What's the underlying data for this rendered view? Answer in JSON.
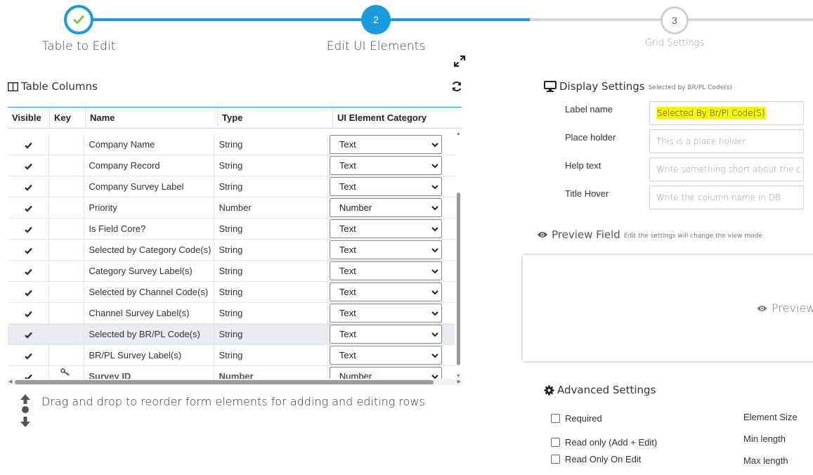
{
  "stepper": {
    "steps": [
      {
        "label": "Table to Edit",
        "number": "",
        "state": "done"
      },
      {
        "label": "Edit UI Elements",
        "number": "2",
        "state": "active"
      },
      {
        "label": "Grid Settings",
        "number": "3",
        "state": "pending"
      }
    ]
  },
  "table_panel": {
    "title": "Table Columns",
    "columns": [
      "Visible",
      "Key",
      "Name",
      "Type",
      "UI Element Category"
    ],
    "rows": [
      {
        "visible": true,
        "key": false,
        "name": "Company Name",
        "type": "String",
        "category": "Text"
      },
      {
        "visible": true,
        "key": false,
        "name": "Company Record",
        "type": "String",
        "category": "Text"
      },
      {
        "visible": true,
        "key": false,
        "name": "Company Survey Label",
        "type": "String",
        "category": "Text"
      },
      {
        "visible": true,
        "key": false,
        "name": "Priority",
        "type": "Number",
        "category": "Number"
      },
      {
        "visible": true,
        "key": false,
        "name": "Is Field Core?",
        "type": "String",
        "category": "Text"
      },
      {
        "visible": true,
        "key": false,
        "name": "Selected by Category Code(s)",
        "type": "String",
        "category": "Text"
      },
      {
        "visible": true,
        "key": false,
        "name": "Category Survey Label(s)",
        "type": "String",
        "category": "Text"
      },
      {
        "visible": true,
        "key": false,
        "name": "Selected by Channel Code(s)",
        "type": "String",
        "category": "Text"
      },
      {
        "visible": true,
        "key": false,
        "name": "Channel Survey Label(s)",
        "type": "String",
        "category": "Text"
      },
      {
        "visible": true,
        "key": false,
        "name": "Selected by BR/PL Code(s)",
        "type": "String",
        "category": "Text",
        "selected": true
      },
      {
        "visible": true,
        "key": false,
        "name": "BR/PL Survey Label(s)",
        "type": "String",
        "category": "Text"
      },
      {
        "visible": true,
        "key": true,
        "name": "Survey ID",
        "type": "Number",
        "category": "Number"
      }
    ],
    "drag_hint": "Drag and drop to reorder form elements for adding and editing rows"
  },
  "display_settings": {
    "title": "Display Settings",
    "subtitle": "Selected by BR/PL Code(s)",
    "label_name": {
      "label": "Label name",
      "value": "Selected By Br/Pl Code(S)"
    },
    "place_holder": {
      "label": "Place holder",
      "placeholder": "This is a place holder"
    },
    "help_text": {
      "label": "Help text",
      "placeholder": "Write something short about the c"
    },
    "title_hover": {
      "label": "Title Hover",
      "placeholder": "Write the column name in DB"
    }
  },
  "preview": {
    "title": "Preview Field",
    "note": "Edit the settings will change the view mode",
    "content": "Preview"
  },
  "advanced": {
    "title": "Advanced Settings",
    "checkboxes": [
      {
        "label": "Required",
        "checked": false
      },
      {
        "label": "Read only (Add + Edit)",
        "checked": false
      },
      {
        "label": "Read Only On Edit",
        "checked": false
      }
    ],
    "right_labels": [
      "Element Size",
      "Min length",
      "Max length"
    ]
  },
  "colors": {
    "accent": "#1a9be0",
    "highlight": "#f7f700",
    "pending": "#d7d7d7",
    "success_check": "#7cc242"
  }
}
